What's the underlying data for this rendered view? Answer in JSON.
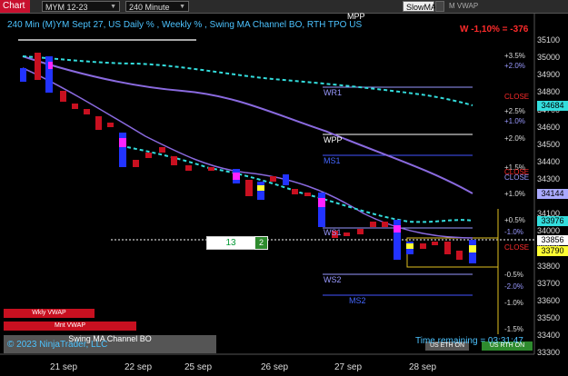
{
  "toolbar": {
    "chart_button": "Chart",
    "instrument": "MYM 12-23",
    "interval": "240 Minute",
    "indicator_1": "SlowMA",
    "indicator_2": "M VWAP"
  },
  "chart": {
    "header": "240 Min (M)YM  Sept 27, US Daily % , Weekly % , Swing MA Channel BO, RTH TPO US",
    "mpp_label": "MPP",
    "performance": "W -1,10% = -376",
    "price_axis": [
      "35100",
      "35000",
      "34900",
      "34800",
      "34700",
      "34600",
      "34500",
      "34400",
      "34300",
      "34200",
      "34100",
      "34000",
      "33900",
      "33800",
      "33700",
      "33600",
      "33500",
      "33400",
      "33300",
      "33200"
    ],
    "price_tags": {
      "p1": "34684",
      "p2": "34144",
      "p3": "33976",
      "p4": "33856",
      "p5": "33790"
    },
    "level_labels": {
      "wr1": "WR1",
      "wpp": "WPP",
      "ms1": "MS1",
      "ws1": "WS1",
      "ws2": "WS2",
      "ms2": "MS2"
    },
    "pct_labels": {
      "p35": "+3.5%",
      "p20": "+2.0%",
      "close1": "CLOSE",
      "p25": "+2.5%",
      "p10a": "+1.0%",
      "p20b": "+2.0%",
      "p15": "+1.5%",
      "close2": "CLOSE",
      "close3": "CLOSE",
      "p10b": "+1.0%",
      "p05": "+0.5%",
      "m10": "-1.0%",
      "close4": "CLOSE",
      "m05": "-0.5%",
      "m20": "-2.0%",
      "m10b": "-1.0%",
      "m15": "-1.5%"
    },
    "signal_box": {
      "count": "13",
      "side": "2"
    },
    "x_axis": [
      "21 sep",
      "22 sep",
      "25 sep",
      "26 sep",
      "27 sep",
      "28 sep"
    ],
    "footer": {
      "wkly_vwap": "Wkly VWAP",
      "mnt_vwap": "Mnt VWAP",
      "swing_label": "Swing MA Channel BO",
      "copyright": "© 2023 NinjaTrader, LLC",
      "time_remaining": "Time remaining = 03:31:47",
      "us_eth_on": "US ETH ON",
      "us_rth_on": "US RTH ON"
    }
  },
  "chart_data": {
    "type": "candlestick",
    "x": [
      "21 sep",
      "",
      "22 sep",
      "",
      "",
      "25 sep",
      "",
      "26 sep",
      "",
      "",
      "27 sep",
      "",
      "28 sep",
      ""
    ],
    "y_range": [
      33200,
      35100
    ]
  }
}
